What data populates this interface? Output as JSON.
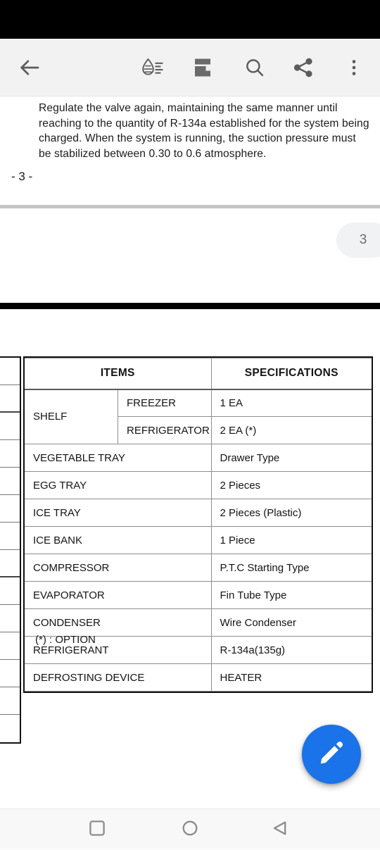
{
  "status_bar": {
    "background": "#000000"
  },
  "toolbar": {
    "background": "#f2f2f2",
    "back_label": "Back",
    "items": [
      {
        "name": "back-arrow-icon",
        "label": "Back"
      },
      {
        "name": "reading-mode-icon",
        "label": "Reading mode"
      },
      {
        "name": "page-layout-icon",
        "label": "Page layout"
      },
      {
        "name": "search-icon",
        "label": "Search"
      },
      {
        "name": "share-icon",
        "label": "Share"
      },
      {
        "name": "overflow-menu-icon",
        "label": "More options"
      }
    ]
  },
  "document": {
    "paragraph": "Regulate the valve again, maintaining the same manner until reaching to the quantity of R-134a established for the system being charged. When the system is running, the suction pressure must be stabilized between 0.30 to 0.6 atmosphere.",
    "page_footer": "- 3 -",
    "page_badge": "3",
    "footnote": "(*) : OPTION"
  },
  "spec_table": {
    "headers": [
      "ITEMS",
      "SPECIFICATIONS"
    ],
    "rows": [
      {
        "item": "SHELF",
        "sub": "FREEZER",
        "spec": "1 EA",
        "rowspan": 2
      },
      {
        "item": "",
        "sub": "REFRIGERATOR",
        "spec": "2 EA (*)"
      },
      {
        "item": "VEGETABLE TRAY",
        "sub": "",
        "spec": "Drawer Type"
      },
      {
        "item": "EGG TRAY",
        "sub": "",
        "spec": "2 Pieces"
      },
      {
        "item": "ICE TRAY",
        "sub": "",
        "spec": "2 Pieces (Plastic)"
      },
      {
        "item": "ICE BANK",
        "sub": "",
        "spec": "1 Piece"
      },
      {
        "item": "COMPRESSOR",
        "sub": "",
        "spec": "P.T.C Starting Type"
      },
      {
        "item": "EVAPORATOR",
        "sub": "",
        "spec": "Fin Tube Type"
      },
      {
        "item": "CONDENSER",
        "sub": "",
        "spec": "Wire Condenser"
      },
      {
        "item": "REFRIGERANT",
        "sub": "",
        "spec": "R-134a(135g)"
      },
      {
        "item": "DEFROSTING DEVICE",
        "sub": "",
        "spec": "HEATER"
      }
    ]
  },
  "fab": {
    "name": "edit-fab",
    "label": "Edit",
    "color": "#1a73e8"
  },
  "nav_bar": {
    "items": [
      {
        "name": "nav-recents-button",
        "label": "Recents"
      },
      {
        "name": "nav-home-button",
        "label": "Home"
      },
      {
        "name": "nav-back-button",
        "label": "Back"
      }
    ]
  }
}
